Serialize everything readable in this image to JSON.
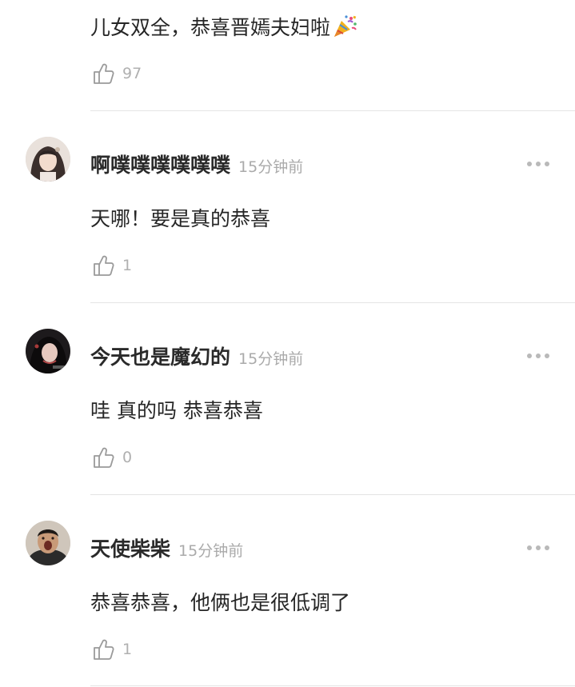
{
  "comments": [
    {
      "text": "儿女双全，恭喜晋嫣夫妇啦",
      "text_emoji": "party-popper-icon",
      "likes": "97"
    },
    {
      "username": "啊噗噗噗噗噗噗",
      "time": "15分钟前",
      "text": "天哪！要是真的恭喜",
      "likes": "1"
    },
    {
      "username": "今天也是魔幻的",
      "time": "15分钟前",
      "text": "哇 真的吗 恭喜恭喜",
      "likes": "0"
    },
    {
      "username": "天使柴柴",
      "time": "15分钟前",
      "text": "恭喜恭喜，他俩也是很低调了",
      "likes": "1"
    }
  ],
  "colors": {
    "username": "#2a2a2a",
    "meta": "#aaaaaa",
    "divider": "#e4e4e4",
    "background": "#ffffff"
  }
}
